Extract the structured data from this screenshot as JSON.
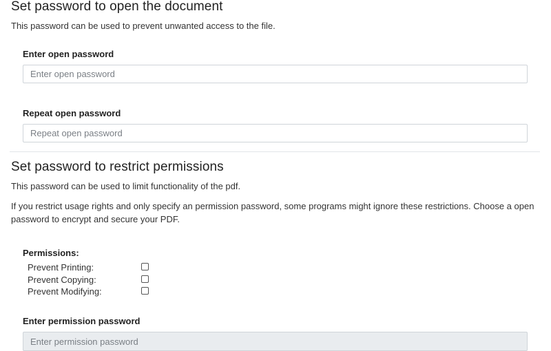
{
  "open_section": {
    "title": "Set password to open the document",
    "description": "This password can be used to prevent unwanted access to the file.",
    "enter_label": "Enter open password",
    "enter_placeholder": "Enter open password",
    "repeat_label": "Repeat open password",
    "repeat_placeholder": "Repeat open password"
  },
  "restrict_section": {
    "title": "Set password to restrict permissions",
    "description": "This password can be used to limit functionality of the pdf.",
    "note_line1": "If you restrict usage rights and only specify an permission password, some programs might ignore these restrictions. Choose a open",
    "note_line2": "password to encrypt and secure your PDF.",
    "permissions_label": "Permissions:",
    "permissions": [
      {
        "label": "Prevent Printing:",
        "checked": false
      },
      {
        "label": "Prevent Copying:",
        "checked": false
      },
      {
        "label": "Prevent Modifying:",
        "checked": false
      }
    ],
    "permission_password_label": "Enter permission password",
    "permission_password_placeholder": "Enter permission password"
  }
}
